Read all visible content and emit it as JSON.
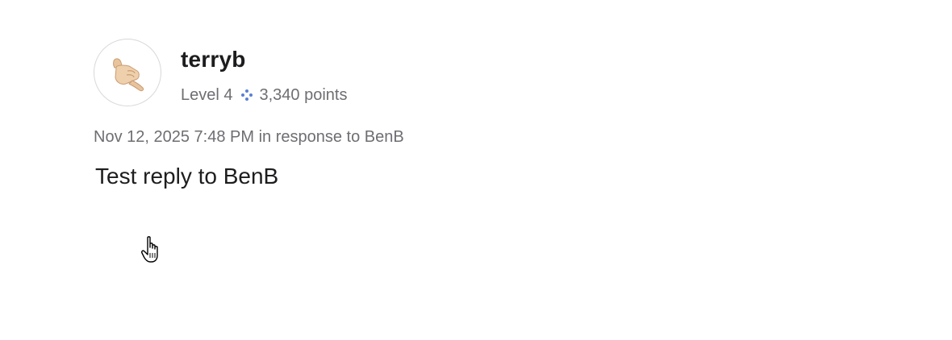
{
  "author": {
    "name": "terryb",
    "level": "Level 4",
    "points": "3,340 points",
    "avatar_icon": "call-me-hand-icon",
    "level_icon": "level-sparkle-icon",
    "level_icon_color": "#5b7fd4"
  },
  "post": {
    "timestamp": "Nov 12, 2025 7:48 PM",
    "response_prefix": "in response to",
    "response_to": "BenB",
    "body": "Test reply to BenB"
  },
  "cursor": {
    "icon": "hand-pointer-cursor-icon"
  }
}
